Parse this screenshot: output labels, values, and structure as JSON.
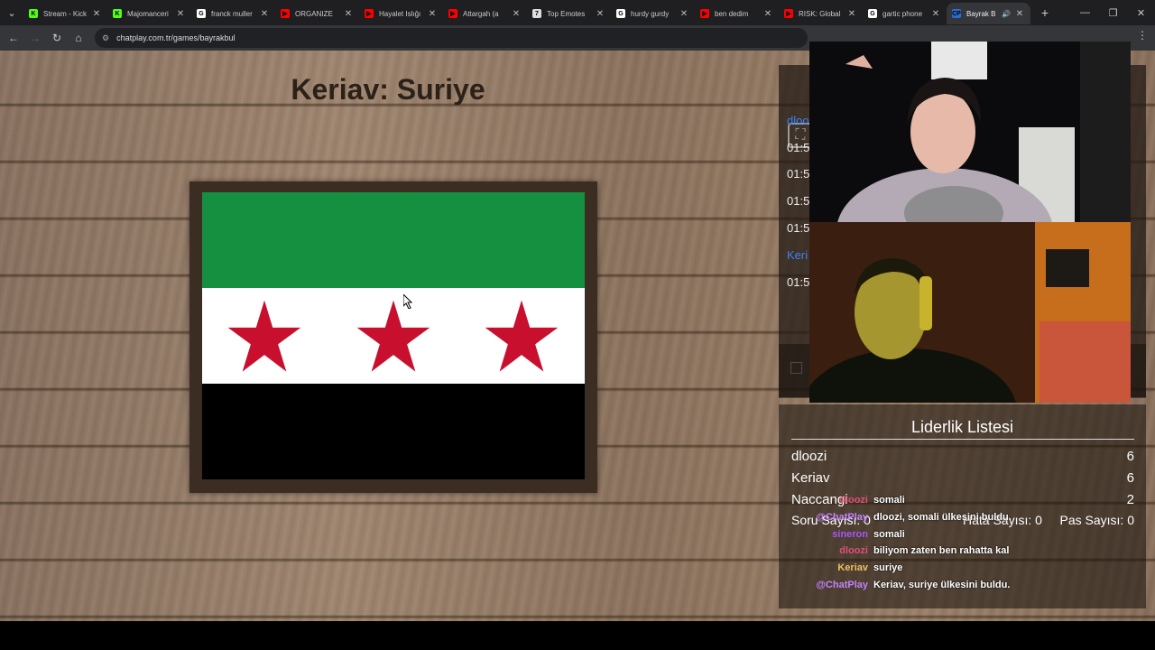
{
  "tabs": [
    {
      "title": "Stream - Kick",
      "fav": "K",
      "fav_color": "#53fc18",
      "active": false
    },
    {
      "title": "Majomanceri",
      "fav": "K",
      "fav_color": "#53fc18",
      "active": false
    },
    {
      "title": "franck muller",
      "fav": "G",
      "fav_color": "#ffffff",
      "active": false
    },
    {
      "title": "ORGANIZE",
      "fav": "▶",
      "fav_color": "#ff0000",
      "active": false
    },
    {
      "title": "Hayalet Islığı",
      "fav": "▶",
      "fav_color": "#ff0000",
      "active": false
    },
    {
      "title": "Attargah (a",
      "fav": "▶",
      "fav_color": "#ff0000",
      "active": false
    },
    {
      "title": "Top Emotes",
      "fav": "7",
      "fav_color": "#dddddd",
      "active": false
    },
    {
      "title": "hurdy gurdy",
      "fav": "G",
      "fav_color": "#ffffff",
      "active": false
    },
    {
      "title": "ben dedim",
      "fav": "▶",
      "fav_color": "#ff0000",
      "active": false
    },
    {
      "title": "RISK: Global",
      "fav": "▶",
      "fav_color": "#ff0000",
      "active": false
    },
    {
      "title": "gartic phone",
      "fav": "G",
      "fav_color": "#ffffff",
      "active": false
    },
    {
      "title": "Bayrak B",
      "fav": "CP",
      "fav_color": "#2a6cd6",
      "active": true
    }
  ],
  "address": {
    "url": "chatplay.com.tr/games/bayrakbul"
  },
  "game": {
    "title": "Keriav: Suriye",
    "flag_colors": {
      "top": "#149040",
      "middle": "#ffffff",
      "bottom": "#000000",
      "star": "#c8102e"
    }
  },
  "side_chat": {
    "times": [
      "01:5",
      "01:5",
      "01:5",
      "01:5",
      "01:5"
    ],
    "users": [
      "dlooz",
      "Keri"
    ]
  },
  "leaderboard": {
    "title": "Liderlik Listesi",
    "rows": [
      {
        "name": "dloozi",
        "score": "6"
      },
      {
        "name": "Keriav",
        "score": "6"
      },
      {
        "name": "Naccangi",
        "score": "2"
      }
    ],
    "questions_label": "Soru Sayısı: 0",
    "errors_label": "Hata Sayısı: 0",
    "passes_label": "Pas Sayısı: 0"
  },
  "chat_overlay": [
    {
      "user": "dloozi",
      "color": "#e04f7a",
      "message": "somali"
    },
    {
      "user": "@ChatPlay",
      "color": "#c084fc",
      "message": "dloozi, somali ülkesini buldu."
    },
    {
      "user": "sineron",
      "color": "#a855f7",
      "message": "somali"
    },
    {
      "user": "dloozi",
      "color": "#e04f7a",
      "message": "biliyom zaten ben rahatta kal"
    },
    {
      "user": "Keriav",
      "color": "#f0c060",
      "message": "suriye"
    },
    {
      "user": "@ChatPlay",
      "color": "#c084fc",
      "message": "Keriav, suriye ülkesini buldu."
    }
  ]
}
